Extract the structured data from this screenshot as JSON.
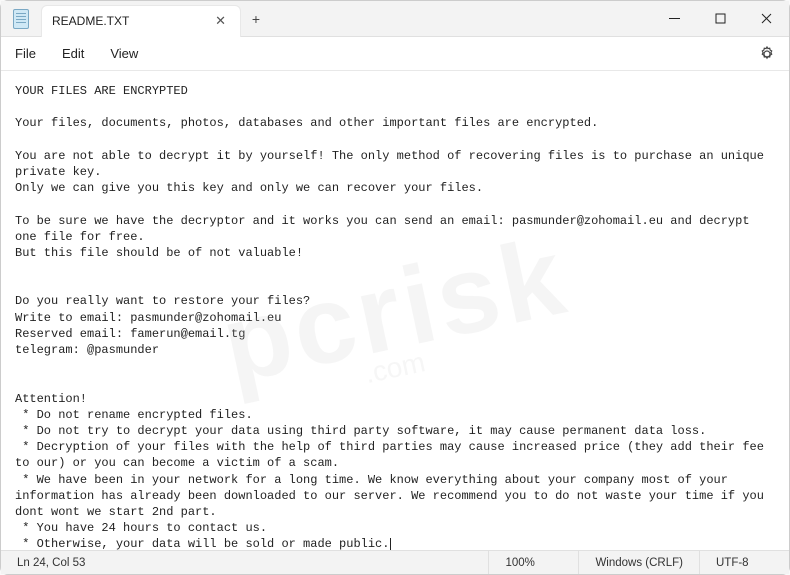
{
  "tab": {
    "title": "README.TXT"
  },
  "menu": {
    "file": "File",
    "edit": "Edit",
    "view": "View"
  },
  "doc": {
    "line1": "YOUR FILES ARE ENCRYPTED",
    "line2": "Your files, documents, photos, databases and other important files are encrypted.",
    "line3": "You are not able to decrypt it by yourself! The only method of recovering files is to purchase an unique private key.",
    "line4": "Only we can give you this key and only we can recover your files.",
    "line5": "To be sure we have the decryptor and it works you can send an email: pasmunder@zohomail.eu and decrypt one file for free.",
    "line6": "But this file should be of not valuable!",
    "line7": "Do you really want to restore your files?",
    "line8": "Write to email: pasmunder@zohomail.eu",
    "line9": "Reserved email: famerun@email.tg",
    "line10": "telegram: @pasmunder",
    "line11": "Attention!",
    "line12": " * Do not rename encrypted files.",
    "line13": " * Do not try to decrypt your data using third party software, it may cause permanent data loss.",
    "line14": " * Decryption of your files with the help of third parties may cause increased price (they add their fee to our) or you can become a victim of a scam.",
    "line15": " * We have been in your network for a long time. We know everything about your company most of your information has already been downloaded to our server. We recommend you to do not waste your time if you dont wont we start 2nd part.",
    "line16": " * You have 24 hours to contact us.",
    "line17": " * Otherwise, your data will be sold or made public."
  },
  "status": {
    "position": "Ln 24, Col 53",
    "zoom": "100%",
    "line_endings": "Windows (CRLF)",
    "encoding": "UTF-8"
  },
  "watermark": {
    "main": "pcrisk",
    "sub": ".com"
  }
}
